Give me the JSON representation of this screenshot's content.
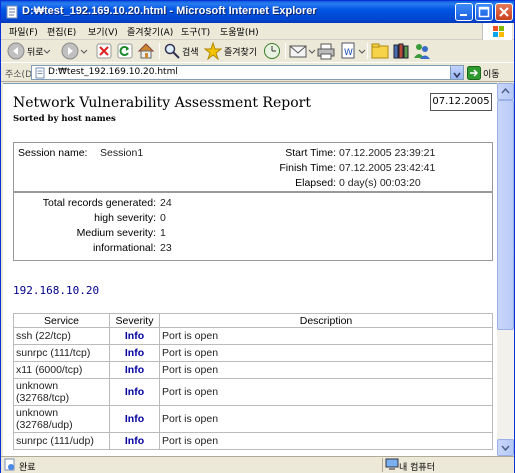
{
  "window": {
    "title": "D:₩test_192.169.10.20.html - Microsoft Internet Explorer"
  },
  "menu": {
    "items": [
      "파일(F)",
      "편집(E)",
      "보기(V)",
      "즐겨찾기(A)",
      "도구(T)",
      "도움말(H)"
    ]
  },
  "toolbar": {
    "back_label": "뒤로",
    "search_label": "검색",
    "favorites_label": "즐겨찾기"
  },
  "address": {
    "label": "주소(D)",
    "value": "D:₩test_192.169.10.20.html",
    "go_label": "이동"
  },
  "report": {
    "title": "Network Vulnerability Assessment Report",
    "subtitle": "Sorted by host names",
    "date": "07.12.2005",
    "session": {
      "name_label": "Session name:",
      "name_value": "Session1",
      "start_label": "Start Time:",
      "start_value": "07.12.2005 23:39:21",
      "finish_label": "Finish Time:",
      "finish_value": "07.12.2005 23:42:41",
      "elapsed_label": "Elapsed:",
      "elapsed_value": "0 day(s) 00:03:20"
    },
    "stats": {
      "total_label": "Total records generated:",
      "total_value": "24",
      "high_label": "high severity:",
      "high_value": "0",
      "medium_label": "Medium severity:",
      "medium_value": "1",
      "info_label": "informational:",
      "info_value": "23"
    },
    "host": "192.168.10.20",
    "table": {
      "headers": [
        "Service",
        "Severity",
        "Description"
      ],
      "rows": [
        {
          "service": "ssh (22/tcp)",
          "severity": "Info",
          "description": "Port is open"
        },
        {
          "service": "sunrpc (111/tcp)",
          "severity": "Info",
          "description": "Port is open"
        },
        {
          "service": "x11 (6000/tcp)",
          "severity": "Info",
          "description": "Port is open"
        },
        {
          "service": "unknown (32768/tcp)",
          "severity": "Info",
          "description": "Port is open"
        },
        {
          "service": "unknown (32768/udp)",
          "severity": "Info",
          "description": "Port is open"
        },
        {
          "service": "sunrpc (111/udp)",
          "severity": "Info",
          "description": "Port is open"
        }
      ]
    }
  },
  "status": {
    "text": "완료",
    "zone": "내 컴퓨터"
  },
  "colors": {
    "title_bar": "#0054e3",
    "host_link": "#00008b",
    "severity_info": "#0000a0"
  }
}
